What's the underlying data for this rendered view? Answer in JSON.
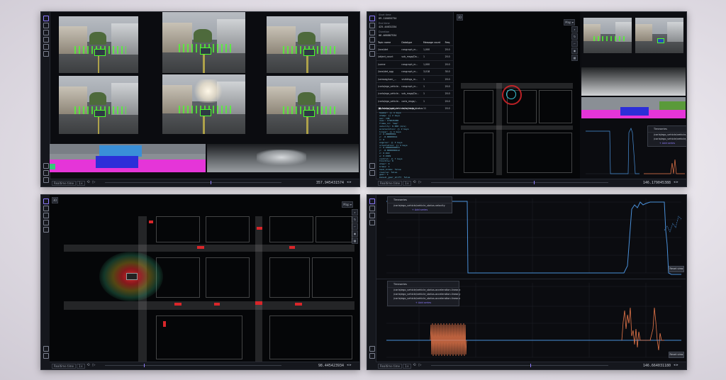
{
  "controls": {
    "play_mode": "Realtime time",
    "speed": "1×",
    "timestamp_w1": "357.945431574",
    "timestamp_w2": "146.179045388",
    "timestamp_w3": "98.445423934",
    "timestamp_w4": "146.664031180",
    "view_3d": "3D",
    "follow": "Map ▾",
    "reset_view": "Reset view"
  },
  "inspector": {
    "fields": [
      {
        "label": "Start time",
        "value": "89.116655734"
      },
      {
        "label": "End time",
        "value": "425.44631334"
      },
      {
        "label": "Duration",
        "value": "06.466887534"
      }
    ],
    "columns": [
      "Topic name",
      "Datatype",
      "Message count",
      "Freq"
    ],
    "rows": [
      [
        "/lane/det",
        "navgraph_m...",
        "1,000",
        "20.0"
      ],
      [
        "/object_count",
        "sub_msgs/Da...",
        "1",
        "20.0"
      ],
      [
        "/scene",
        "navgraph_m...",
        "1,000",
        "20.0"
      ],
      [
        "/lane/det_agg",
        "navgraph_m...",
        "3,018",
        "30.0"
      ],
      [
        "/semseg/cam_...",
        "visibilngs_m...",
        "1",
        "20.0"
      ],
      [
        "/carla/ego_vehicle...",
        "navgraph_m...",
        "1",
        "20.0"
      ],
      [
        "/carla/ego_vehicle...",
        "sub_msgs/Do...",
        "1",
        "20.0"
      ],
      [
        "/carla/ego_vehicle...",
        "carla_msgs/...",
        "1",
        "20.0"
      ],
      [
        "/carla/ego_vehicle...",
        "carla_msgs/...",
        "11",
        "20.0"
      ]
    ],
    "raw_topic": "/carla/ego_vehicle/vehicle_status",
    "raw_lines": [
      "header: {} 4 keys",
      "  stamp: {} 2 keys",
      "    sec: 146",
      "    nsec: 179045388",
      "  frame_id: \"map\"",
      "velocity: 0.000 (m/s)",
      "acceleration: {} 2 keys",
      "  linear: {} 3 keys",
      "    x: 0.00000001",
      "    y: -0.00000012",
      "    z: 0",
      "  angular: {} 3 keys",
      "orientation: {} 4 keys",
      "  x: 0.00000000021",
      "  y: -0.0000000412",
      "  z: 0.010",
      "  w: 0.9999",
      "control: {} 7 keys",
      "  throttle: 0",
      "  steer: 0",
      "  brake: 1",
      "  hand_brake: false",
      "  reverse: false",
      "  gear: 1",
      "  manual_gear_shift: false"
    ]
  },
  "plot_legend": {
    "title": "Timeseries",
    "items": [
      "/carla/ego_vehicle/vehicle_status",
      "/carla/ego_vehicle/vehicle_status"
    ],
    "add": "+ Add series"
  },
  "plot_top": {
    "title": "Timeseries",
    "items": [
      "/carla/ego_vehicle/vehicle_status.velocity"
    ],
    "add": "+ Add series"
  },
  "plot_bottom": {
    "title": "Timeseries",
    "items": [
      "/carla/ego_vehicle/vehicle_status.acceleration.linear.x",
      "/carla/ego_vehicle/vehicle_status.acceleration.linear.y",
      "/carla/ego_vehicle/vehicle_status.acceleration.linear.z"
    ],
    "add": "+ Add series"
  },
  "colors": {
    "accent": "#8f7cff",
    "series_blue": "#4a90d9",
    "series_orange": "#e8774a",
    "lidar_red": "#d9262a",
    "seg_magenta": "#e535d8",
    "seg_blue": "#2c2ed8",
    "detect_green": "#4cff2c"
  }
}
